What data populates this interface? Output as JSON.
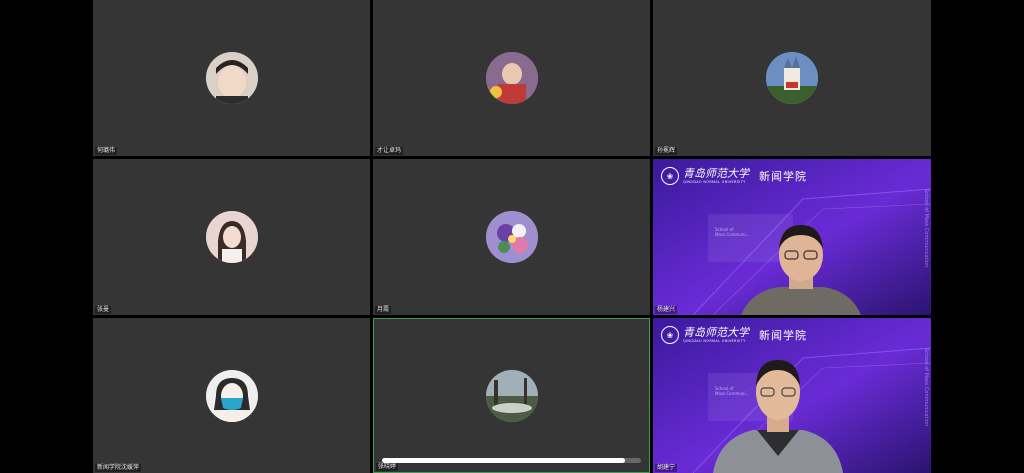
{
  "participants": [
    {
      "name": "何璐伟",
      "avatar": "child-photo-avatar",
      "avatar_color": "#d9d0c6"
    },
    {
      "name": "才让卓玛",
      "avatar": "kids-photo-avatar",
      "avatar_color": "#8a6a8f"
    },
    {
      "name": "孙冕辉",
      "avatar": "castle-photo-avatar",
      "avatar_color": "#6b8fc2"
    },
    {
      "name": "张曼",
      "avatar": "girl-photo-avatar",
      "avatar_color": "#e8d4d0"
    },
    {
      "name": "月霞",
      "avatar": "flowers-photo-avatar",
      "avatar_color": "#9e8fcf"
    },
    {
      "name": "杨建兴",
      "video": true
    },
    {
      "name": "新闻学院沈媛萍",
      "avatar": "masked-girl-drawing-avatar",
      "avatar_color": "#efefef"
    },
    {
      "name": "张晓婷",
      "avatar": "landscape-photo-avatar",
      "avatar_color": "#7c8a6c",
      "active": true,
      "progress": 0.94
    },
    {
      "name": "胡建宁",
      "video": true
    }
  ],
  "virtual_background": {
    "university_cn": "青岛师范大学",
    "university_en": "QINGDAO NORMAL UNIVERSITY",
    "college": "新闻学院",
    "side_text": "School of Mass Communication",
    "inner_lines": [
      "School of",
      "Mass Communi..."
    ],
    "accent": "#6a2bd6"
  }
}
